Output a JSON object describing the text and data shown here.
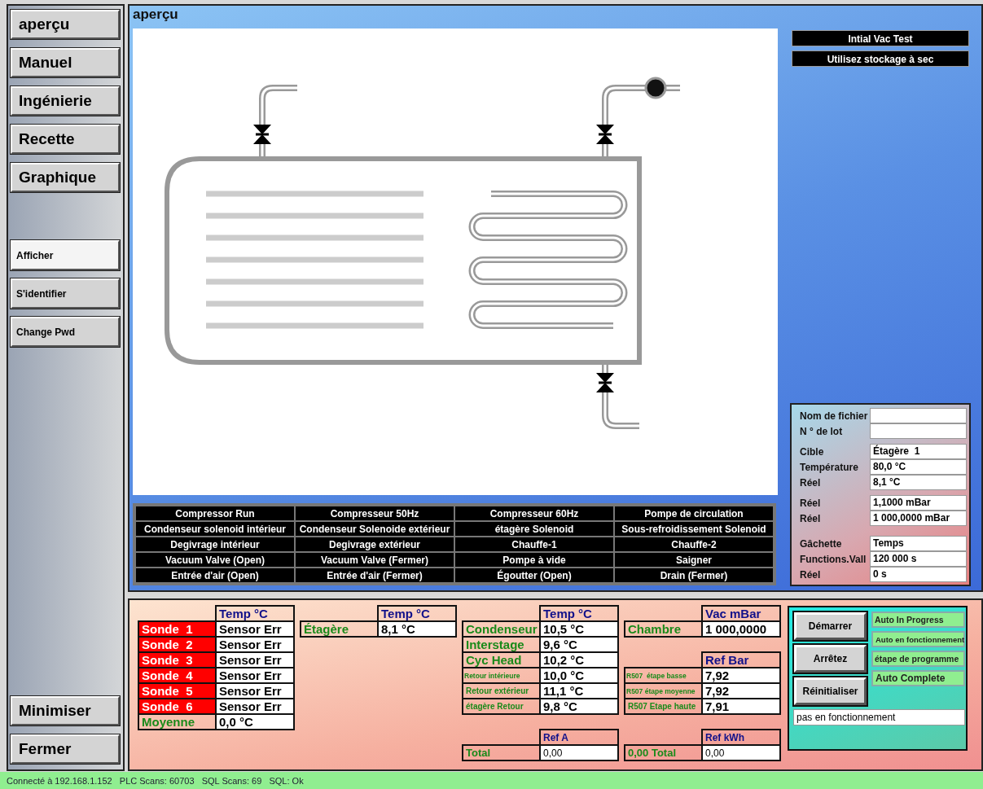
{
  "sidebar": {
    "nav": [
      "aperçu",
      "Manuel",
      "Ingénierie",
      "Recette",
      "Graphique"
    ],
    "tools": [
      {
        "label": "Afficher",
        "selected": true
      },
      {
        "label": "S'identifier",
        "selected": false
      },
      {
        "label": "Change Pwd",
        "selected": false
      }
    ],
    "window_buttons": [
      "Minimiser",
      "Fermer"
    ]
  },
  "overview": {
    "title": "aperçu",
    "outputs": [
      [
        "Compressor Run",
        "Compresseur 50Hz",
        "Compresseur 60Hz",
        "Pompe de circulation"
      ],
      [
        "Condenseur solenoid intérieur",
        "Condenseur Solenoide extérieur",
        "étagère Solenoid",
        "Sous-refroidissement Solenoid"
      ],
      [
        "Degivrage intérieur",
        "Degivrage extérieur",
        "Chauffe-1",
        "Chauffe-2"
      ],
      [
        "Vacuum Valve (Open)",
        "Vacuum Valve (Fermer)",
        "Pompe à vide",
        "Saigner"
      ],
      [
        "Entrée d'air (Open)",
        "Entrée d'air (Fermer)",
        "Égoutter (Open)",
        "Drain (Fermer)"
      ]
    ],
    "banners": [
      "Intial Vac Test",
      "Utilisez stockage à sec"
    ],
    "info_groups": [
      [
        {
          "label": "Nom de fichier"
        },
        {
          "label": "N ° de lot"
        }
      ],
      [
        {
          "label": "Cible",
          "value": "Étagère  1"
        },
        {
          "label": "Température",
          "value": "80,0 °C"
        },
        {
          "label": "Réel",
          "value": "8,1 °C"
        }
      ],
      [
        {
          "label": "Réel",
          "value": "1,1000 mBar"
        },
        {
          "label": "Réel",
          "value": "1 000,0000 mBar"
        }
      ],
      [
        {
          "label": "Gâchette",
          "value": "Temps"
        },
        {
          "label": "Functions.Vall",
          "value": "120 000 s"
        },
        {
          "label": "Réel",
          "value": "0 s"
        }
      ]
    ]
  },
  "readings": [
    [
      {
        "kind": "normal",
        "header": "Temp °C",
        "rows": [
          {
            "label": "Sonde  1",
            "value": "Sensor Err",
            "alarm": true
          },
          {
            "label": "Sonde  2",
            "value": "Sensor Err",
            "alarm": true
          },
          {
            "label": "Sonde  3",
            "value": "Sensor Err",
            "alarm": true
          },
          {
            "label": "Sonde  4",
            "value": "Sensor Err",
            "alarm": true
          },
          {
            "label": "Sonde  5",
            "value": "Sensor Err",
            "alarm": true
          },
          {
            "label": "Sonde  6",
            "value": "Sensor Err",
            "alarm": true
          },
          {
            "label": "Moyenne",
            "value": "0,0 °C",
            "alarm": false
          }
        ]
      }
    ],
    [
      {
        "kind": "normal",
        "header": "Temp °C",
        "rows": [
          {
            "label": "Étagère",
            "value": "8,1 °C",
            "alarm": false
          }
        ]
      }
    ],
    [
      {
        "kind": "normal",
        "header": "Temp °C",
        "rows": [
          {
            "label": "Condenseur",
            "value": "10,5 °C",
            "alarm": false
          },
          {
            "label": "Interstage",
            "value": "9,6 °C",
            "alarm": false
          },
          {
            "label": "Cyc Head",
            "value": "10,2 °C",
            "alarm": false
          },
          {
            "label": "Retour intérieure",
            "value": "10,0 °C",
            "alarm": false
          },
          {
            "label": "Retour extérieur",
            "value": "11,1 °C",
            "alarm": false
          },
          {
            "label": "étagère Retour",
            "value": "9,8 °C",
            "alarm": false
          }
        ]
      },
      {
        "kind": "compact",
        "header": "Ref A",
        "rows": [
          {
            "label": "Total",
            "value": "0,00",
            "alarm": false
          }
        ]
      }
    ],
    [
      {
        "kind": "normal",
        "header": "Vac mBar",
        "rows": [
          {
            "label": "Chambre",
            "value": "1 000,0000",
            "alarm": false
          }
        ]
      },
      {
        "kind": "normal",
        "header": "Ref Bar",
        "rows": [
          {
            "label": "R507  étape basse",
            "value": "7,92",
            "alarm": false
          },
          {
            "label": "R507 étape moyenne",
            "value": "7,92",
            "alarm": false
          },
          {
            "label": "R507 Etape haute",
            "value": "7,91",
            "alarm": false
          }
        ]
      },
      {
        "kind": "compact",
        "header": "Ref kWh",
        "rows": [
          {
            "label": "0,00 Total",
            "value": "0,00",
            "alarm": false
          }
        ]
      }
    ]
  ],
  "control": {
    "buttons": [
      "Démarrer",
      "Arrêtez",
      "Réinitialiser"
    ],
    "indicators": [
      "Auto In Progress",
      "Auto en fonctionnement",
      "étape de programme",
      "Auto Complete"
    ],
    "message": "pas en fonctionnement"
  },
  "status_bar": "Connecté à 192.168.1.152   PLC Scans: 60703   SQL Scans: 69   SQL: Ok"
}
